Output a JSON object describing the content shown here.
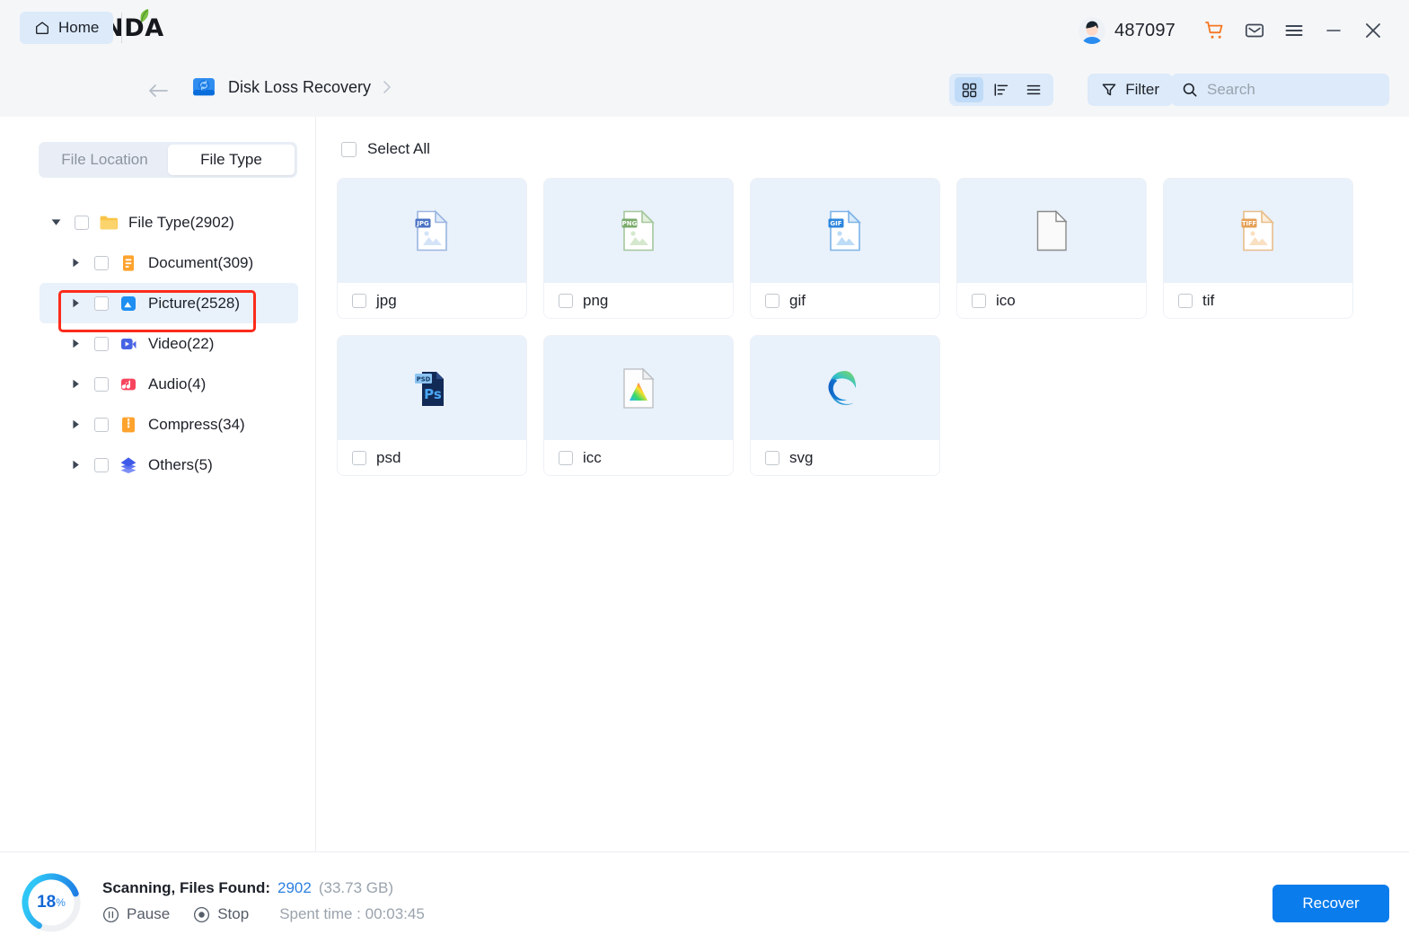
{
  "app": {
    "brand": "PANDA",
    "user_id": "487097"
  },
  "titlebar": {
    "icons": [
      {
        "name": "cart-icon",
        "label": "Cart"
      },
      {
        "name": "mail-icon",
        "label": "Messages"
      },
      {
        "name": "menu-icon",
        "label": "Menu"
      },
      {
        "name": "minimize-icon",
        "label": "Minimize"
      },
      {
        "name": "close-icon",
        "label": "Close"
      }
    ]
  },
  "navbar": {
    "home_label": "Home",
    "breadcrumb_label": "Disk Loss Recovery",
    "filter_label": "Filter",
    "search_placeholder": "Search",
    "search_value": "",
    "view_modes": [
      {
        "name": "grid-view",
        "active": true
      },
      {
        "name": "sort-view",
        "active": false
      },
      {
        "name": "list-view",
        "active": false
      }
    ]
  },
  "sidebar": {
    "tabs": [
      {
        "label": "File Location",
        "active": false
      },
      {
        "label": "File Type",
        "active": true
      }
    ],
    "tree": [
      {
        "label": "File Type(2902)",
        "level": 0,
        "icon": "folder-icon",
        "expanded": true,
        "selected": false,
        "checked": false
      },
      {
        "label": "Document(309)",
        "level": 1,
        "icon": "document-icon",
        "expanded": false,
        "selected": false,
        "checked": false
      },
      {
        "label": "Picture(2528)",
        "level": 1,
        "icon": "picture-icon",
        "expanded": false,
        "selected": true,
        "checked": false
      },
      {
        "label": "Video(22)",
        "level": 1,
        "icon": "video-icon",
        "expanded": false,
        "selected": false,
        "checked": false
      },
      {
        "label": "Audio(4)",
        "level": 1,
        "icon": "audio-icon",
        "expanded": false,
        "selected": false,
        "checked": false
      },
      {
        "label": "Compress(34)",
        "level": 1,
        "icon": "compress-icon",
        "expanded": false,
        "selected": false,
        "checked": false
      },
      {
        "label": "Others(5)",
        "level": 1,
        "icon": "others-icon",
        "expanded": false,
        "selected": false,
        "checked": false
      }
    ]
  },
  "main": {
    "select_all_label": "Select All",
    "cards": [
      {
        "label": "jpg",
        "icon": "jpg-file-icon",
        "checked": false
      },
      {
        "label": "png",
        "icon": "png-file-icon",
        "checked": false
      },
      {
        "label": "gif",
        "icon": "gif-file-icon",
        "checked": false
      },
      {
        "label": "ico",
        "icon": "blank-file-icon",
        "checked": false
      },
      {
        "label": "tif",
        "icon": "tiff-file-icon",
        "checked": false
      },
      {
        "label": "psd",
        "icon": "psd-file-icon",
        "checked": false
      },
      {
        "label": "icc",
        "icon": "icc-file-icon",
        "checked": false
      },
      {
        "label": "svg",
        "icon": "edge-browser-icon",
        "checked": false
      }
    ]
  },
  "footer": {
    "progress_value": "18",
    "progress_unit": "%",
    "status_label": "Scanning, Files Found:",
    "files_found": "2902",
    "files_size": "(33.73 GB)",
    "pause_label": "Pause",
    "stop_label": "Stop",
    "spent_time": "Spent time : 00:03:45",
    "recover_label": "Recover"
  },
  "colors": {
    "accent": "#0a7cec",
    "chip": "#dceafa",
    "thumb": "#e9f1fb",
    "annotation": "#fc2b1b",
    "progress_from": "#1b6fe0",
    "progress_to": "#2fc6f6"
  }
}
